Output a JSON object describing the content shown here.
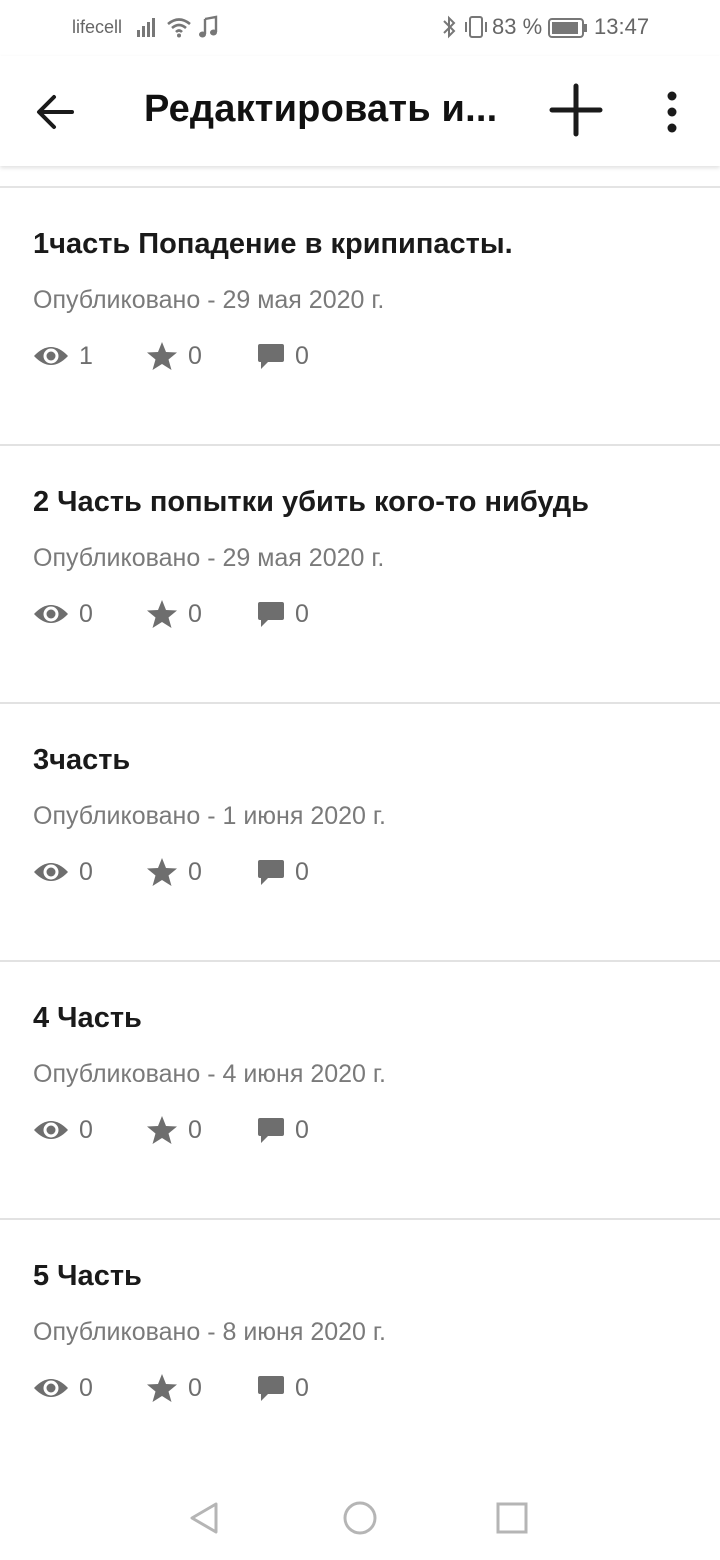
{
  "status_bar": {
    "carrier": "lifecell",
    "battery": "83 %",
    "time": "13:47",
    "icons": [
      "signal-icon",
      "wifi-icon",
      "music-icon",
      "bluetooth-icon",
      "vibrate-icon",
      "battery-icon"
    ]
  },
  "app_bar": {
    "title": "Редактировать и...",
    "icons": [
      "back-arrow-icon",
      "add-icon",
      "more-vert-icon"
    ]
  },
  "parts": [
    {
      "title": "1часть Попадение в крипипасты.",
      "date": "Опубликовано - 29 мая 2020 г.",
      "views": "1",
      "stars": "0",
      "comments": "0"
    },
    {
      "title": "2 Часть попытки убить кого-то нибудь",
      "date": "Опубликовано - 29 мая 2020 г.",
      "views": "0",
      "stars": "0",
      "comments": "0"
    },
    {
      "title": "3часть",
      "date": "Опубликовано - 1 июня 2020 г.",
      "views": "0",
      "stars": "0",
      "comments": "0"
    },
    {
      "title": "4 Часть",
      "date": "Опубликовано - 4 июня 2020 г.",
      "views": "0",
      "stars": "0",
      "comments": "0"
    },
    {
      "title": "5 Часть",
      "date": "Опубликовано - 8 июня 2020 г.",
      "views": "0",
      "stars": "0",
      "comments": "0"
    }
  ],
  "nav_bar": {
    "icons": [
      "nav-back-icon",
      "nav-home-icon",
      "nav-recents-icon"
    ]
  },
  "colors": {
    "text_primary": "#1a1a1a",
    "text_secondary": "#7a7a7a",
    "icon_gray": "#6e6e6e",
    "divider": "#e2e2e2"
  }
}
